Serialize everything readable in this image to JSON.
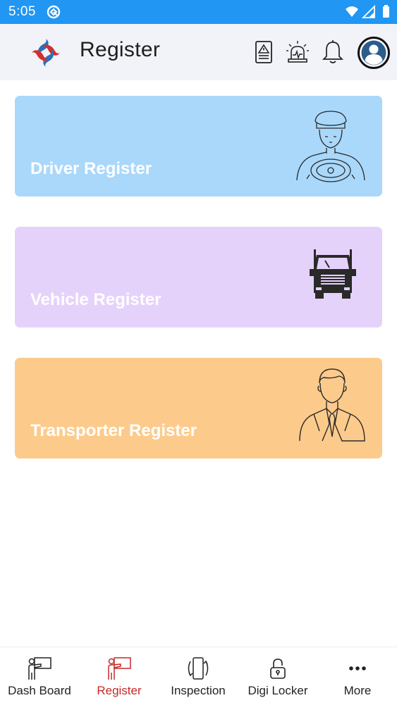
{
  "status_bar": {
    "time": "5:05"
  },
  "header": {
    "title": "Register"
  },
  "cards": [
    {
      "label": "Driver Register"
    },
    {
      "label": "Vehicle Register"
    },
    {
      "label": "Transporter Register"
    }
  ],
  "bottom_nav": [
    {
      "label": "Dash Board",
      "icon": "presenter-icon"
    },
    {
      "label": "Register",
      "icon": "presenter-icon",
      "active": true
    },
    {
      "label": "Inspection",
      "icon": "phone-rotate-icon"
    },
    {
      "label": "Digi Locker",
      "icon": "lock-icon"
    },
    {
      "label": "More",
      "icon": "more-dots-icon"
    }
  ],
  "colors": {
    "status_bar": "#2196f3",
    "app_bar": "#f1f3f8",
    "driver_card": "#a9d8fb",
    "vehicle_card": "#e5d2fb",
    "transporter_card": "#fccb8c",
    "active_nav": "#c62828"
  }
}
